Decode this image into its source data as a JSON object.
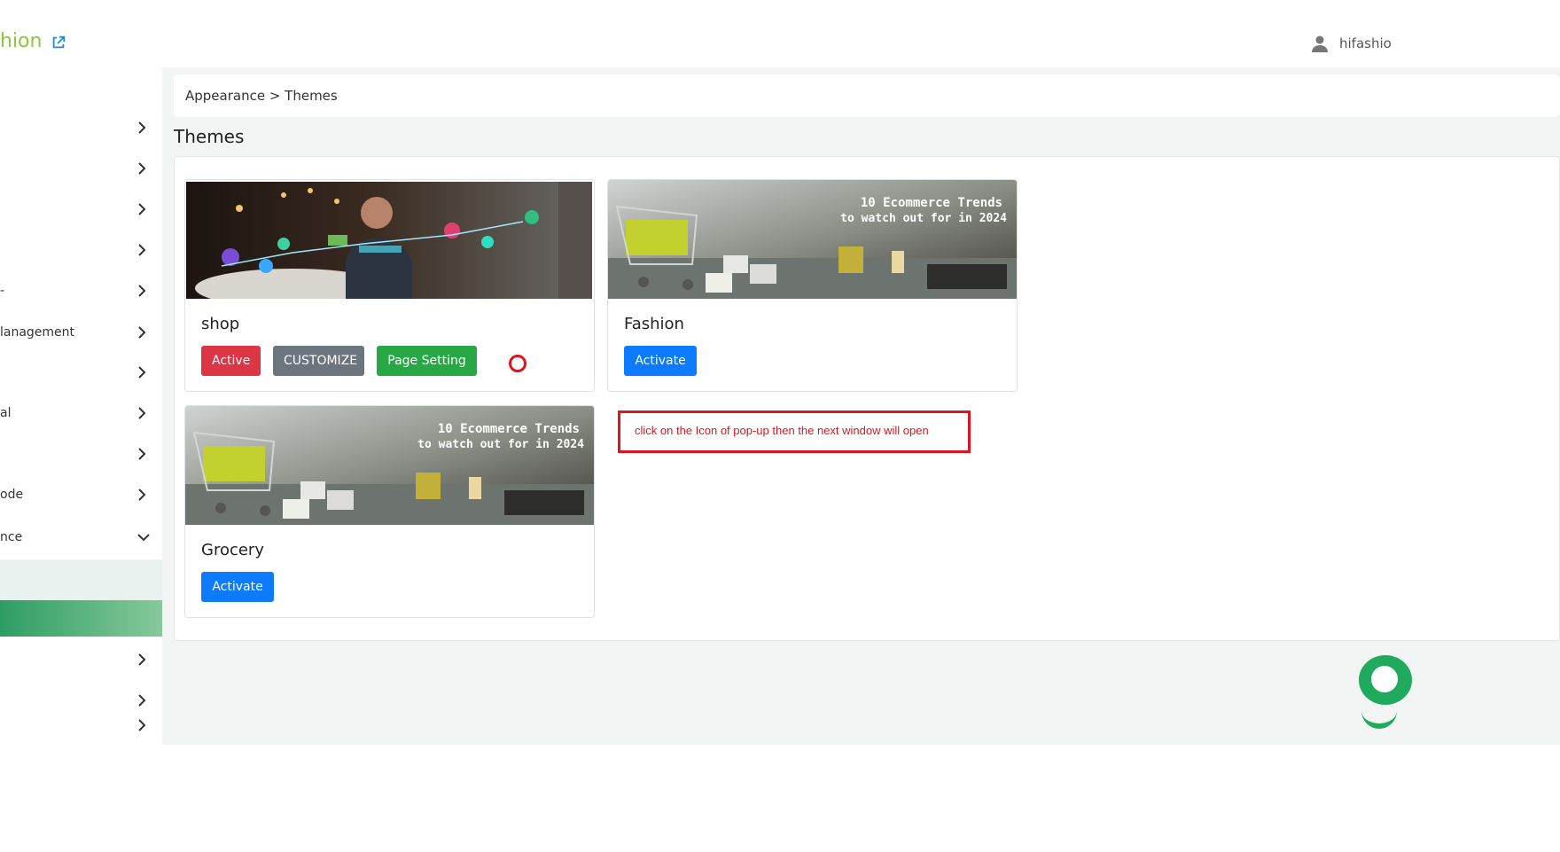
{
  "header": {
    "brand": "hion",
    "user": "hifashio"
  },
  "sidebar": {
    "items": [
      {
        "label": ""
      },
      {
        "label": ""
      },
      {
        "label": ""
      },
      {
        "label": ""
      },
      {
        "label": "-"
      },
      {
        "label": "lanagement"
      },
      {
        "label": ""
      },
      {
        "label": "al"
      },
      {
        "label": ""
      },
      {
        "label": "ode"
      },
      {
        "label": "nce"
      },
      {
        "label": ""
      },
      {
        "label": ""
      },
      {
        "label": ""
      }
    ]
  },
  "breadcrumb": {
    "text": "Appearance > Themes"
  },
  "page": {
    "title": "Themes"
  },
  "themes": [
    {
      "name": "shop",
      "buttons": [
        "Active",
        "CUSTOMIZE",
        "Page Setting"
      ]
    },
    {
      "name": "Fashion",
      "banner": "10 Ecommerce Trends\nto watch out for in 2024",
      "buttons": [
        "Activate"
      ]
    },
    {
      "name": "Grocery",
      "banner": "10 Ecommerce Trends\nto watch out for in 2024",
      "buttons": [
        "Activate"
      ]
    }
  ],
  "annotation": {
    "text": "click on the Icon of pop-up then the next window will open"
  },
  "colors": {
    "brand": "#8dc63f",
    "active": "#dc3545",
    "customize": "#6c757d",
    "page_setting": "#28a745",
    "activate": "#0d7bff",
    "annotation": "#e0141e"
  }
}
